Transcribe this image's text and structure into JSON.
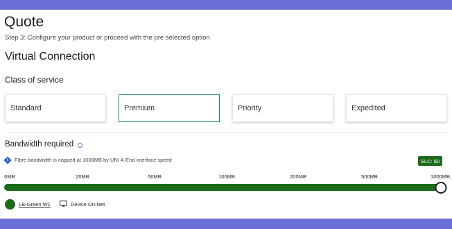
{
  "page": {
    "title": "Quote",
    "step": "Step 3: Configure your product or proceed with the pre selected option",
    "section_title": "Virtual Connection"
  },
  "class_of_service": {
    "title": "Class of service",
    "options": [
      "Standard",
      "Premium",
      "Priority",
      "Expedited"
    ],
    "selected": "Premium"
  },
  "bandwidth": {
    "title": "Bandwidth required",
    "info_icon": "info-circle-icon",
    "note_icon": "info-diamond-icon",
    "note": "Fibre bandwidth is capped at 1000MB by UNI A-End interface speed",
    "slc_badge": "SLC: $0",
    "ticks": [
      "0MB",
      "20MB",
      "50MB",
      "100MB",
      "200MB",
      "500MB",
      "1000MB"
    ],
    "selected_value": "1000MB",
    "slider_fraction": 1.0
  },
  "legend": {
    "swatch_color": "#1b6b1b",
    "swatch_label": "LB-Green W1",
    "device_icon": "cast-icon",
    "device_label": "Device On-Net"
  },
  "colors": {
    "accent_green": "#1b6b1b",
    "selected_border": "#1f7f7f",
    "frame_background": "#6b6fd8"
  }
}
